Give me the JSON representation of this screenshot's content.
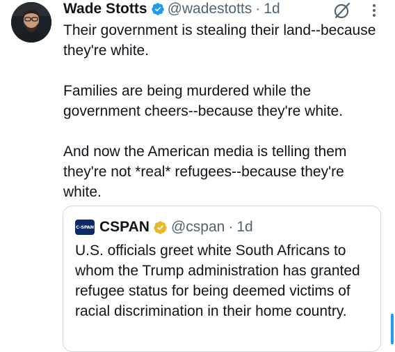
{
  "tweet": {
    "author": {
      "name": "Wade Stotts",
      "handle": "@wadestotts",
      "separator": "·",
      "time": "1d",
      "verified_color": "#1d9bf0"
    },
    "icons": {
      "grok": "grok-icon",
      "more": "more-options-icon"
    },
    "paragraphs": [
      "Their government is stealing their land--because they're white.",
      "Families are being murdered while the government cheers--because they're white.",
      "And now the American media is telling them they're not *real* refugees--because they're white."
    ]
  },
  "quote": {
    "avatar_text": "C-SPAN",
    "name": "CSPAN",
    "handle": "@cspan",
    "separator": "·",
    "time": "1d",
    "verified_color": "#e8b829",
    "text": "U.S. officials greet white South Africans to whom the Trump administration has granted refugee status for being deemed victims of racial discrimination in their home country."
  },
  "colors": {
    "text": "#0f1419",
    "secondary": "#536471",
    "border": "#cfd9de",
    "accent": "#1d9bf0"
  }
}
